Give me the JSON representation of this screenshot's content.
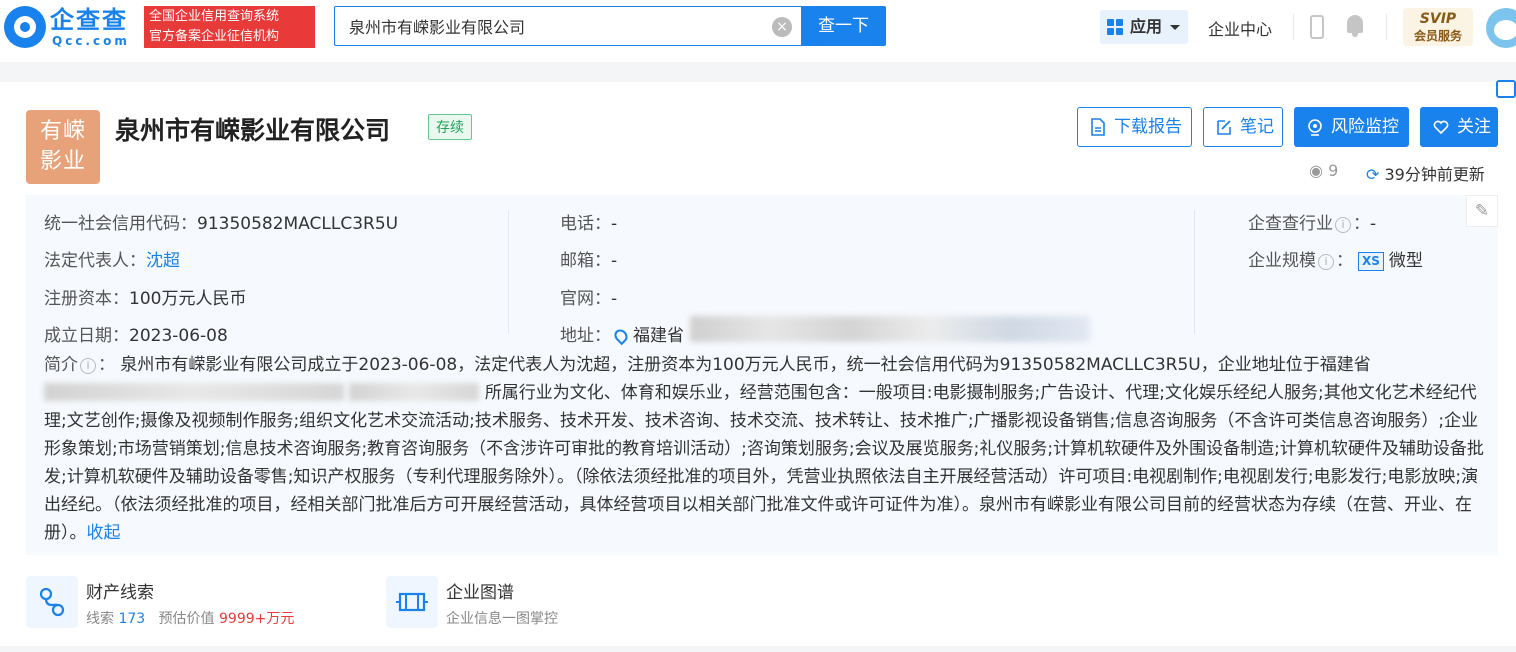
{
  "header": {
    "logo_cn": "企查查",
    "logo_en": "Qcc.com",
    "badge_line1": "全国企业信用查询系统",
    "badge_line2": "官方备案企业征信机构",
    "search_value": "泉州市有嵘影业有限公司",
    "search_button": "查一下",
    "apps_label": "应用",
    "enterprise_center": "企业中心",
    "svip_line1": "SVIP",
    "svip_line2": "会员服务"
  },
  "company": {
    "logo_line1": "有嵘",
    "logo_line2": "影业",
    "name": "泉州市有嵘影业有限公司",
    "status": "存续",
    "views": "9",
    "updated": "39分钟前更新",
    "buttons": {
      "download": "下载报告",
      "note": "笔记",
      "monitor": "风险监控",
      "follow": "关注"
    }
  },
  "info": {
    "credit_code_label": "统一社会信用代码：",
    "credit_code": "91350582MACLLC3R5U",
    "legal_rep_label": "法定代表人：",
    "legal_rep": "沈超",
    "capital_label": "注册资本：",
    "capital": "100万元人民币",
    "found_date_label": "成立日期：",
    "found_date": "2023-06-08",
    "phone_label": "电话：",
    "phone": "-",
    "email_label": "邮箱：",
    "email": "-",
    "website_label": "官网：",
    "website": "-",
    "address_label": "地址：",
    "address": "福建省",
    "industry_label": "企查查行业",
    "industry": "-",
    "scale_label": "企业规模",
    "scale_badge": "XS",
    "scale": "微型"
  },
  "intro": {
    "label": "简介",
    "text1": "泉州市有嵘影业有限公司成立于2023-06-08，法定代表人为沈超，注册资本为100万元人民币，统一社会信用代码为91350582MACLLC3R5U，企业地址位于福建省",
    "text2": "所属行业为文化、体育和娱乐业，经营范围包含：一般项目:电影摄制服务;广告设计、代理;文化娱乐经纪人服务;其他文化艺术经纪代理;文艺创作;摄像及视频制作服务;组织文化艺术交流活动;技术服务、技术开发、技术咨询、技术交流、技术转让、技术推广;广播影视设备销售;信息咨询服务（不含许可类信息咨询服务）;企业形象策划;市场营销策划;信息技术咨询服务;教育咨询服务（不含涉许可审批的教育培训活动）;咨询策划服务;会议及展览服务;礼仪服务;计算机软硬件及外围设备制造;计算机软硬件及辅助设备批发;计算机软硬件及辅助设备零售;知识产权服务（专利代理服务除外）。（除依法须经批准的项目外，凭营业执照依法自主开展经营活动）许可项目:电视剧制作;电视剧发行;电影发行;电影放映;演出经纪。（依法须经批准的项目，经相关部门批准后方可开展经营活动，具体经营项目以相关部门批准文件或许可证件为准）。泉州市有嵘影业有限公司目前的经营状态为存续（在营、开业、在册）。",
    "collapse": "收起"
  },
  "cards": {
    "assets_title": "财产线索",
    "assets_clue_label": "线索",
    "assets_clue_count": "173",
    "assets_value_label": "预估价值",
    "assets_value": "9999+万元",
    "graph_title": "企业图谱",
    "graph_sub": "企业信息一图掌控"
  }
}
